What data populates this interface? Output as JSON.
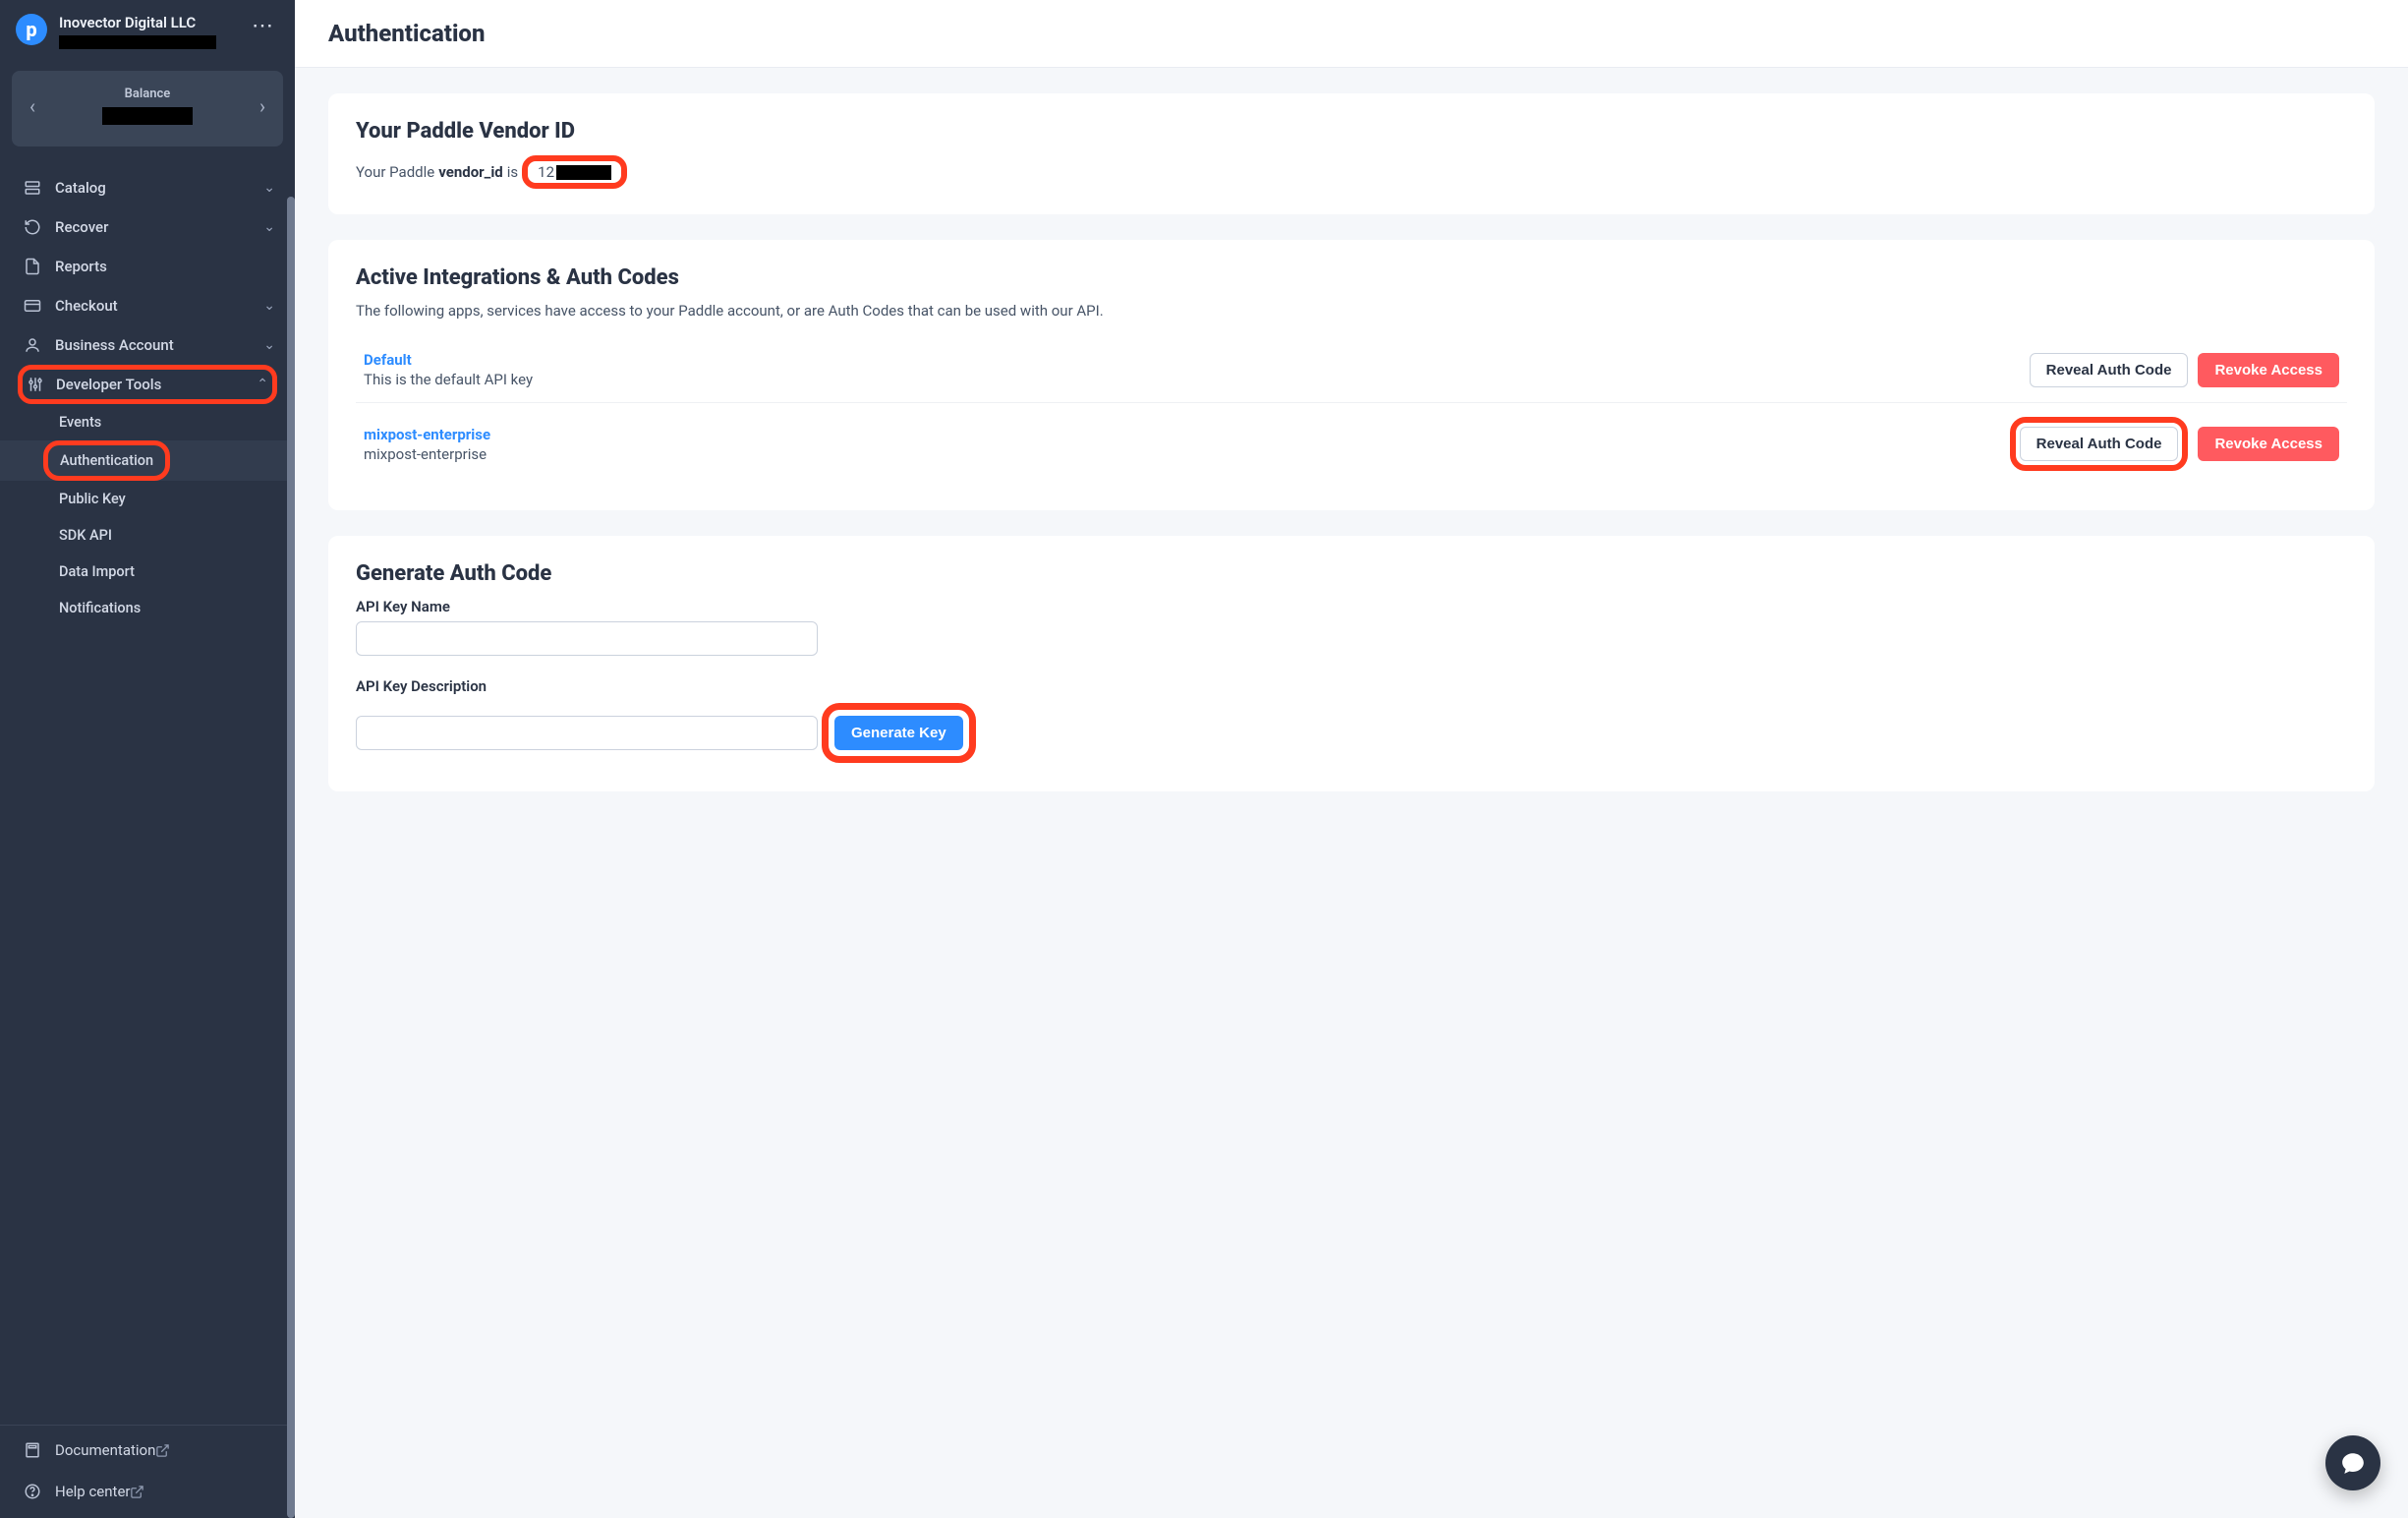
{
  "colors": {
    "accent_blue": "#2d8cff",
    "danger_red": "#ff5a5f",
    "annotation_red": "#ff3b1f",
    "sidebar_bg": "#2a3344"
  },
  "org": {
    "logo_letter": "p",
    "name": "Inovector Digital LLC"
  },
  "balance": {
    "label": "Balance"
  },
  "nav": {
    "catalog": "Catalog",
    "recover": "Recover",
    "reports": "Reports",
    "checkout": "Checkout",
    "business_account": "Business Account",
    "developer_tools": "Developer Tools",
    "subnav": {
      "events": "Events",
      "authentication": "Authentication",
      "public_key": "Public Key",
      "sdk_api": "SDK API",
      "data_import": "Data Import",
      "notifications": "Notifications"
    }
  },
  "footer_nav": {
    "documentation": "Documentation",
    "help_center": "Help center"
  },
  "page_title": "Authentication",
  "vendor_card": {
    "heading": "Your Paddle Vendor ID",
    "line_prefix": "Your Paddle",
    "line_bold": "vendor_id",
    "line_after_bold": "is",
    "id_visible_prefix": "12"
  },
  "integrations_card": {
    "heading": "Active Integrations & Auth Codes",
    "subtitle": "The following apps, services have access to your Paddle account, or are Auth Codes that can be used with our API.",
    "rows": [
      {
        "name": "Default",
        "desc": "This is the default API key"
      },
      {
        "name": "mixpost-enterprise",
        "desc": "mixpost-enterprise"
      }
    ],
    "reveal_label": "Reveal Auth Code",
    "revoke_label": "Revoke Access"
  },
  "generate_card": {
    "heading": "Generate Auth Code",
    "name_label": "API Key Name",
    "desc_label": "API Key Description",
    "button_label": "Generate Key"
  }
}
